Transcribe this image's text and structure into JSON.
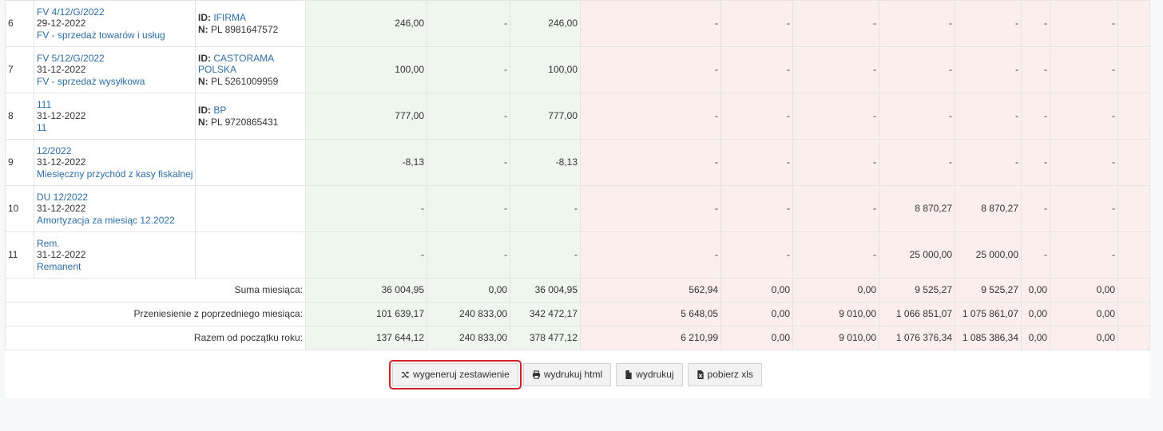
{
  "rows": [
    {
      "lp": "6",
      "doc_number": "FV 4/12/G/2022",
      "date": "29-12-2022",
      "description": "FV - sprzedaż towarów i usług",
      "contractor_id_label": "ID:",
      "contractor_name": "IFIRMA",
      "contractor_name_cont": "",
      "contractor_nip_label": "N:",
      "contractor_nip": "PL 8981647572",
      "values": [
        "246,00",
        "-",
        "246,00",
        "-",
        "-",
        "-",
        "-",
        "-",
        "-",
        "-"
      ]
    },
    {
      "lp": "7",
      "doc_number": "FV 5/12/G/2022",
      "date": "31-12-2022",
      "description": "FV - sprzedaż wysyłkowa",
      "contractor_id_label": "ID:",
      "contractor_name": "CASTORAMA",
      "contractor_name_cont": "POLSKA",
      "contractor_nip_label": "N:",
      "contractor_nip": "PL 5261009959",
      "values": [
        "100,00",
        "-",
        "100,00",
        "-",
        "-",
        "-",
        "-",
        "-",
        "-",
        "-"
      ]
    },
    {
      "lp": "8",
      "doc_number": "111",
      "date": "31-12-2022",
      "description": "11",
      "contractor_id_label": "ID:",
      "contractor_name": "BP",
      "contractor_name_cont": "",
      "contractor_nip_label": "N:",
      "contractor_nip": "PL 9720865431",
      "values": [
        "777,00",
        "-",
        "777,00",
        "-",
        "-",
        "-",
        "-",
        "-",
        "-",
        "-"
      ]
    },
    {
      "lp": "9",
      "doc_number": "12/2022",
      "date": "31-12-2022",
      "description": "Miesięczny przychód z kasy fiskalnej",
      "contractor_id_label": "",
      "contractor_name": "",
      "contractor_name_cont": "",
      "contractor_nip_label": "",
      "contractor_nip": "",
      "values": [
        "-8,13",
        "-",
        "-8,13",
        "-",
        "-",
        "-",
        "-",
        "-",
        "-",
        "-"
      ]
    },
    {
      "lp": "10",
      "doc_number": "DU 12/2022",
      "date": "31-12-2022",
      "description": "Amortyzacja za miesiąc 12.2022",
      "contractor_id_label": "",
      "contractor_name": "",
      "contractor_name_cont": "",
      "contractor_nip_label": "",
      "contractor_nip": "",
      "values": [
        "-",
        "-",
        "-",
        "-",
        "-",
        "-",
        "8 870,27",
        "8 870,27",
        "-",
        "-"
      ]
    },
    {
      "lp": "11",
      "doc_number": "Rem.",
      "date": "31-12-2022",
      "description": "Remanent",
      "contractor_id_label": "",
      "contractor_name": "",
      "contractor_name_cont": "",
      "contractor_nip_label": "",
      "contractor_nip": "",
      "values": [
        "-",
        "-",
        "-",
        "-",
        "-",
        "-",
        "25 000,00",
        "25 000,00",
        "-",
        "-"
      ]
    }
  ],
  "summary_rows": [
    {
      "label": "Suma miesiąca:",
      "values": [
        "36 004,95",
        "0,00",
        "36 004,95",
        "562,94",
        "0,00",
        "0,00",
        "9 525,27",
        "9 525,27",
        "0,00",
        "0,00"
      ]
    },
    {
      "label": "Przeniesienie z poprzedniego miesiąca:",
      "values": [
        "101 639,17",
        "240 833,00",
        "342 472,17",
        "5 648,05",
        "0,00",
        "9 010,00",
        "1 066 851,07",
        "1 075 861,07",
        "0,00",
        "0,00"
      ]
    },
    {
      "label": "Razem od początku roku:",
      "values": [
        "137 644,12",
        "240 833,00",
        "378 477,12",
        "6 210,99",
        "0,00",
        "9 010,00",
        "1 076 376,34",
        "1 085 386,34",
        "0,00",
        "0,00"
      ]
    }
  ],
  "buttons": {
    "generate": {
      "label": "wygeneruj zestawienie",
      "icon": "shuffle-icon"
    },
    "print_html": {
      "label": "wydrukuj html",
      "icon": "printer-icon"
    },
    "print": {
      "label": "wydrukuj",
      "icon": "document-icon"
    },
    "download_xls": {
      "label": "pobierz xls",
      "icon": "excel-file-icon"
    }
  },
  "colors": {
    "income_bg": "#eef6ee",
    "expense_bg": "#fbeeed",
    "link": "#2e6da4",
    "highlight": "#d0202a"
  }
}
